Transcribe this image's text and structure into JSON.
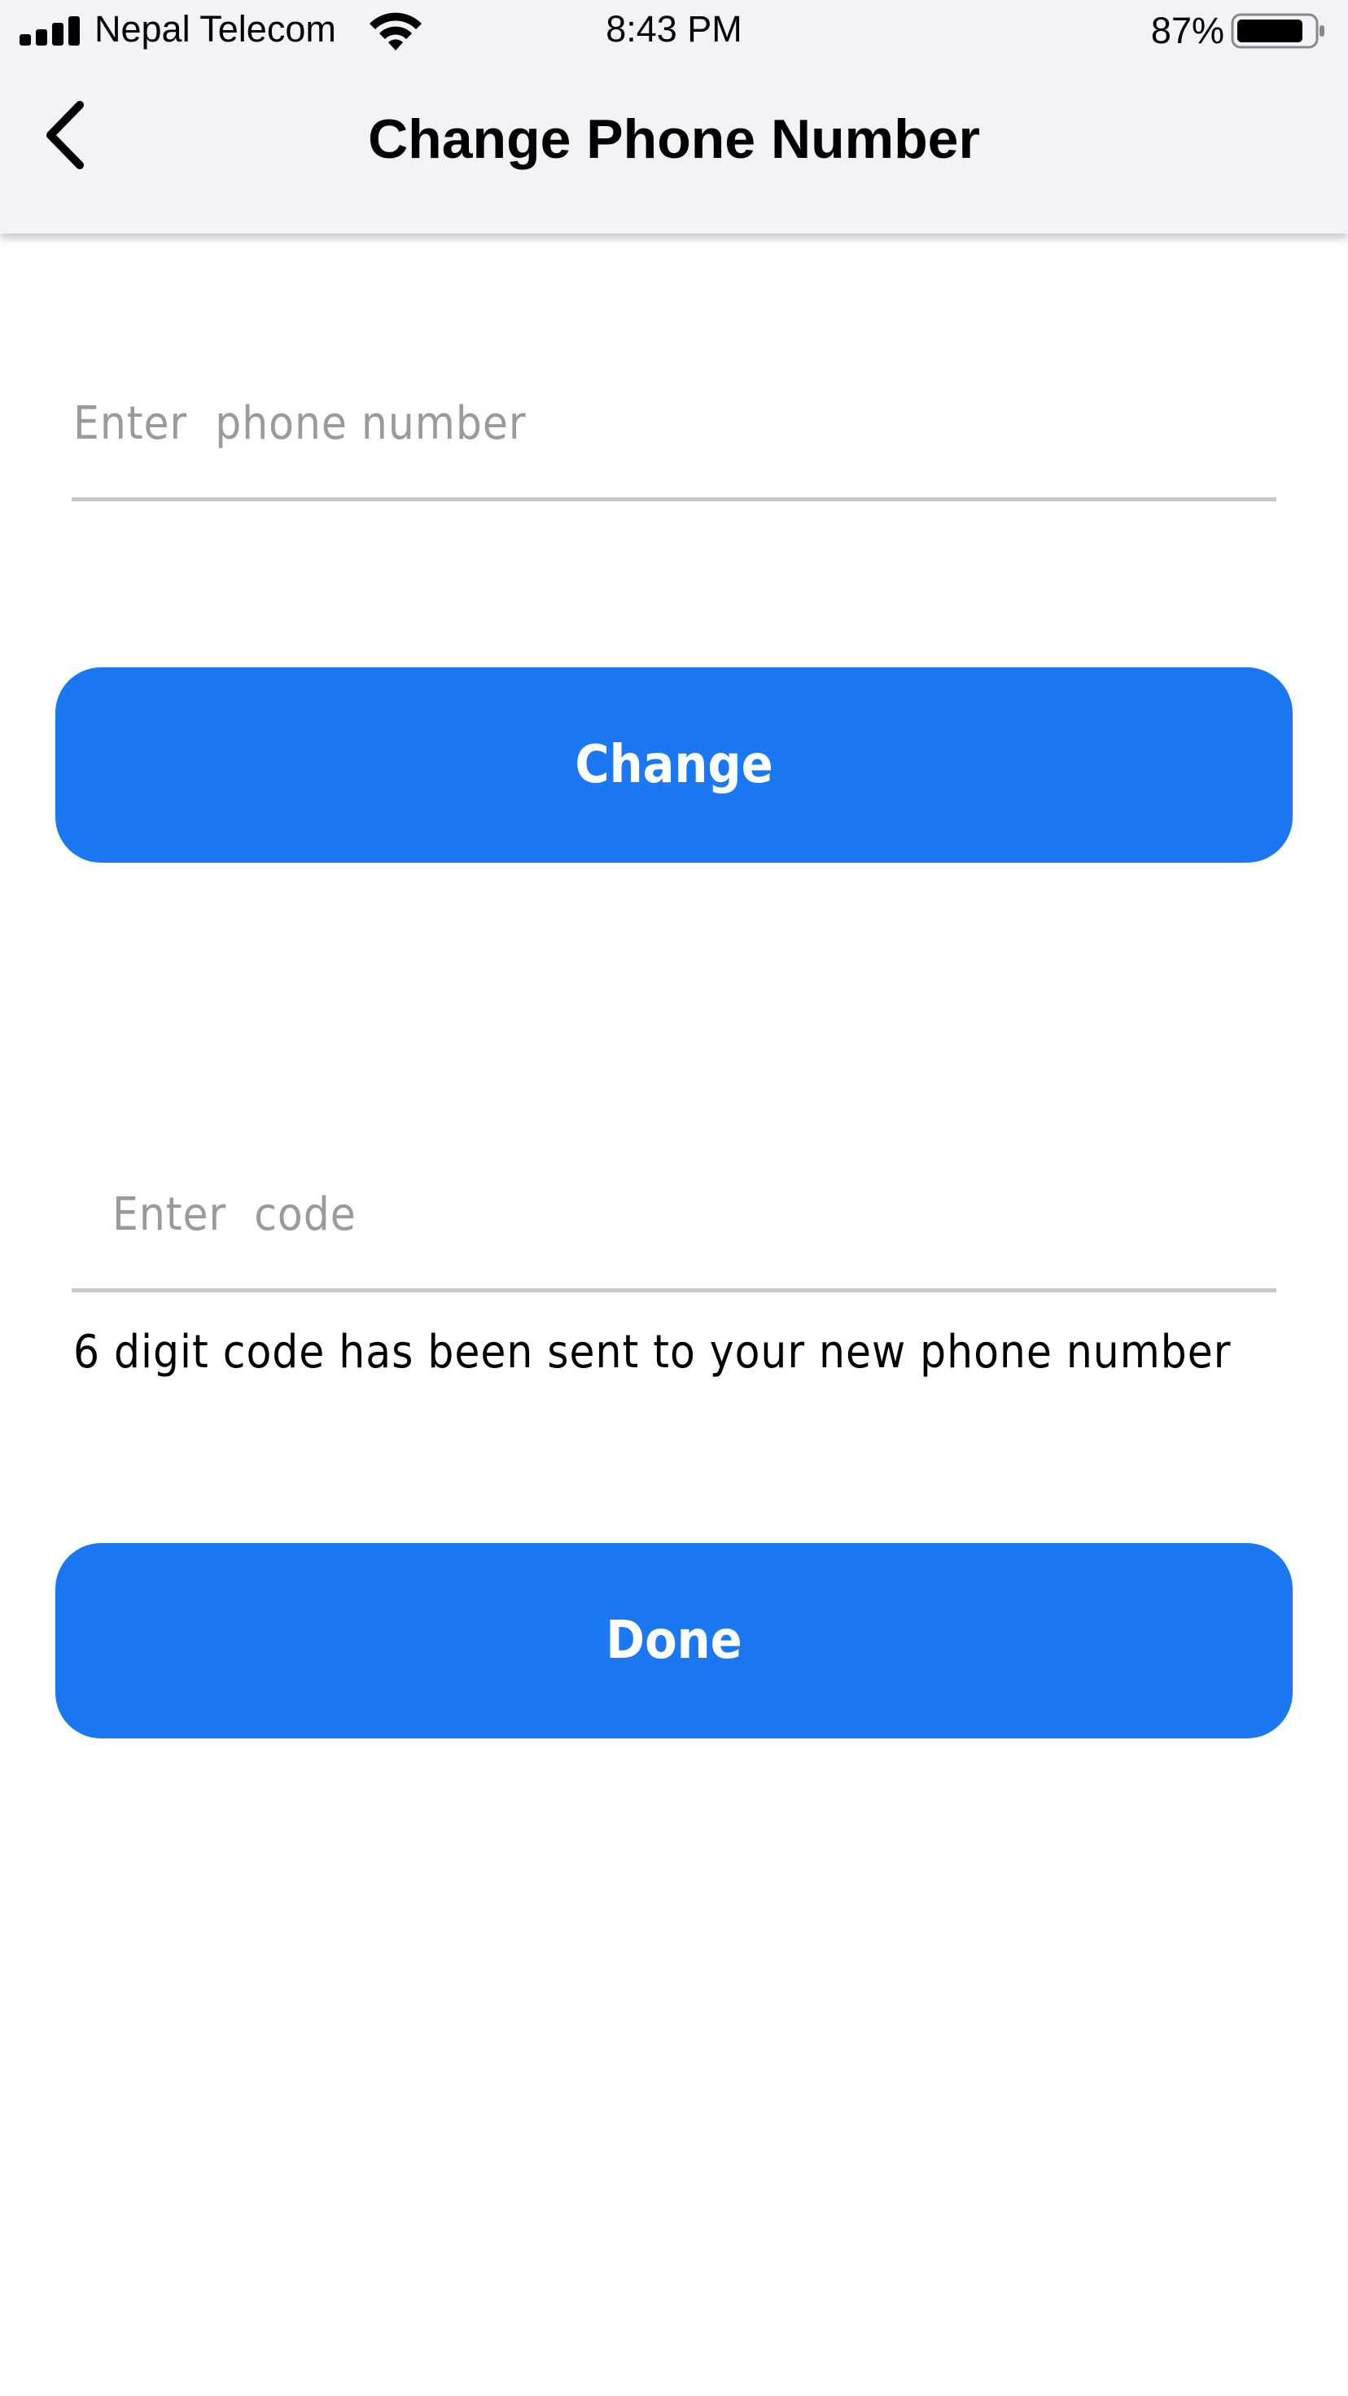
{
  "status_bar": {
    "carrier": "Nepal Telecom",
    "time": "8:43 PM",
    "battery_percent": "87%",
    "signal_icon": "cellular-signal-icon",
    "wifi_icon": "wifi-icon",
    "battery_icon": "battery-icon",
    "battery_level": 0.87
  },
  "nav": {
    "back_icon": "chevron-left-icon",
    "title": "Change Phone Number"
  },
  "form": {
    "phone_placeholder": "Enter  phone number",
    "phone_value": "",
    "change_label": "Change",
    "code_placeholder": "Enter  code",
    "code_value": "",
    "hint": "6 digit code has been sent to your new phone number",
    "done_label": "Done"
  },
  "colors": {
    "primary": "#1b77f2",
    "header_bg": "#f2f2f7",
    "divider": "#c8c8c8",
    "placeholder": "#9a9a9a"
  }
}
